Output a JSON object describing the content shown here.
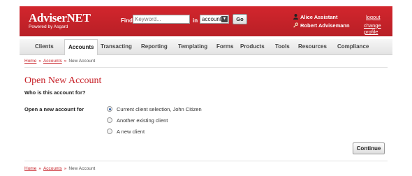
{
  "brand": {
    "name": "AdviserNET",
    "tagline": "Powered by Asgard"
  },
  "search": {
    "label": "Find",
    "placeholder": "Keyword...",
    "in_label": "in",
    "scope": "accounts",
    "go_label": "Go"
  },
  "user": {
    "assistant": "Alice Assistant",
    "adviser": "Robert Advisemann",
    "logout_label": "logout",
    "change_profile_label": "change profile"
  },
  "nav": {
    "items": [
      {
        "label": "Clients"
      },
      {
        "label": "Accounts"
      },
      {
        "label": "Transacting"
      },
      {
        "label": "Reporting"
      },
      {
        "label": "Templating"
      },
      {
        "label": "Forms"
      },
      {
        "label": "Products"
      },
      {
        "label": "Tools"
      },
      {
        "label": "Resources"
      },
      {
        "label": "Compliance"
      }
    ],
    "active": "Accounts"
  },
  "breadcrumb": {
    "home": "Home",
    "accounts": "Accounts",
    "current": "New Account",
    "separator": "»"
  },
  "page": {
    "title": "Open New Account",
    "question": "Who is this account for?",
    "open_label": "Open a new account for",
    "options": [
      {
        "label": "Current client selection, John Citizen",
        "checked": true
      },
      {
        "label": "Another existing client",
        "checked": false
      },
      {
        "label": "A new client",
        "checked": false
      }
    ],
    "continue_label": "Continue"
  },
  "colors": {
    "brand_red": "#c8242b",
    "radio_selected": "#2d5fa8"
  }
}
